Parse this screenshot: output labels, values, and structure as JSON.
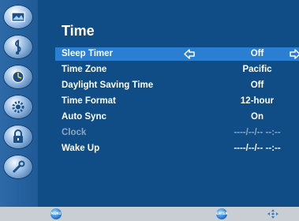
{
  "menu": {
    "title": "Time",
    "items": [
      {
        "label": "Sleep Timer",
        "value": "Off",
        "selected": true
      },
      {
        "label": "Time Zone",
        "value": "Pacific"
      },
      {
        "label": "Daylight Saving Time",
        "value": "Off"
      },
      {
        "label": "Time Format",
        "value": "12-hour"
      },
      {
        "label": "Auto Sync",
        "value": "On"
      },
      {
        "label": "Clock",
        "value": "----/--/--  --:--",
        "disabled": true
      },
      {
        "label": "Wake Up",
        "value": "----/--/--  --:--"
      }
    ]
  },
  "sidebar": {
    "icons": [
      "picture-icon",
      "sound-icon",
      "channel-icon",
      "settings-icon",
      "lock-icon",
      "tools-icon"
    ],
    "active": "picture-icon"
  },
  "footer": {
    "menu_key": "MENU",
    "enter_key": "ENTER",
    "nav_icon": "navigate-arrows-icon"
  },
  "colors": {
    "background": "#0f4a82",
    "highlight": "#2a7fd3",
    "text": "#ffffff",
    "disabled_text": "#8ea7bf",
    "footer": "#c9cdd4"
  }
}
